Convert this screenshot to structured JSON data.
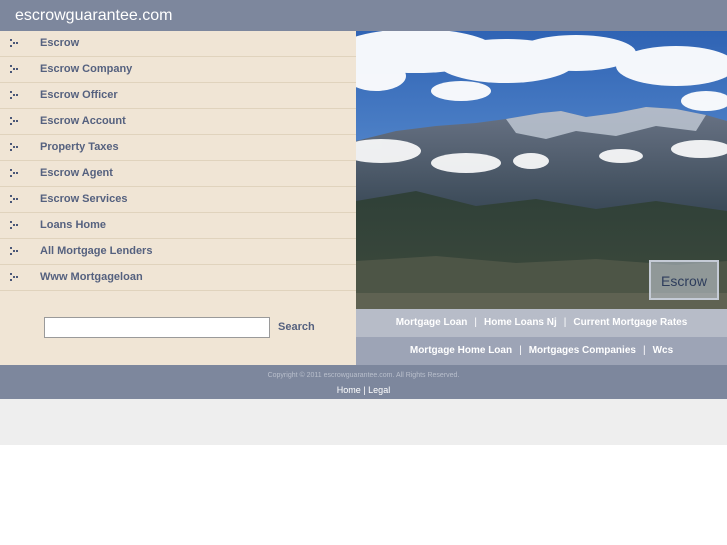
{
  "header": {
    "title": "escrowguarantee.com"
  },
  "sidebar": {
    "items": [
      {
        "label": "Escrow"
      },
      {
        "label": "Escrow Company"
      },
      {
        "label": "Escrow Officer"
      },
      {
        "label": "Escrow Account"
      },
      {
        "label": "Property Taxes"
      },
      {
        "label": "Escrow Agent"
      },
      {
        "label": "Escrow Services"
      },
      {
        "label": "Loans Home"
      },
      {
        "label": "All Mortgage Lenders"
      },
      {
        "label": "Www Mortgageloan"
      }
    ],
    "search": {
      "value": "",
      "button_label": "Search"
    }
  },
  "hero": {
    "badge_label": "Escrow"
  },
  "links": {
    "row1": [
      "Mortgage Loan",
      "Home Loans Nj",
      "Current Mortgage Rates"
    ],
    "row2": [
      "Mortgage Home Loan",
      "Mortgages Companies",
      "Wcs"
    ],
    "separator": "|"
  },
  "footer": {
    "copyright": "Copyright © 2011 escrowguarantee.com. All Rights Reserved.",
    "home_label": "Home",
    "separator": "|",
    "legal_label": "Legal"
  },
  "colors": {
    "header_bg": "#7d879d",
    "sidebar_bg": "#f0e5d5",
    "link_text": "#55617f",
    "links_bar_light": "#b7bcc8",
    "links_bar_dark": "#9da4b6"
  }
}
